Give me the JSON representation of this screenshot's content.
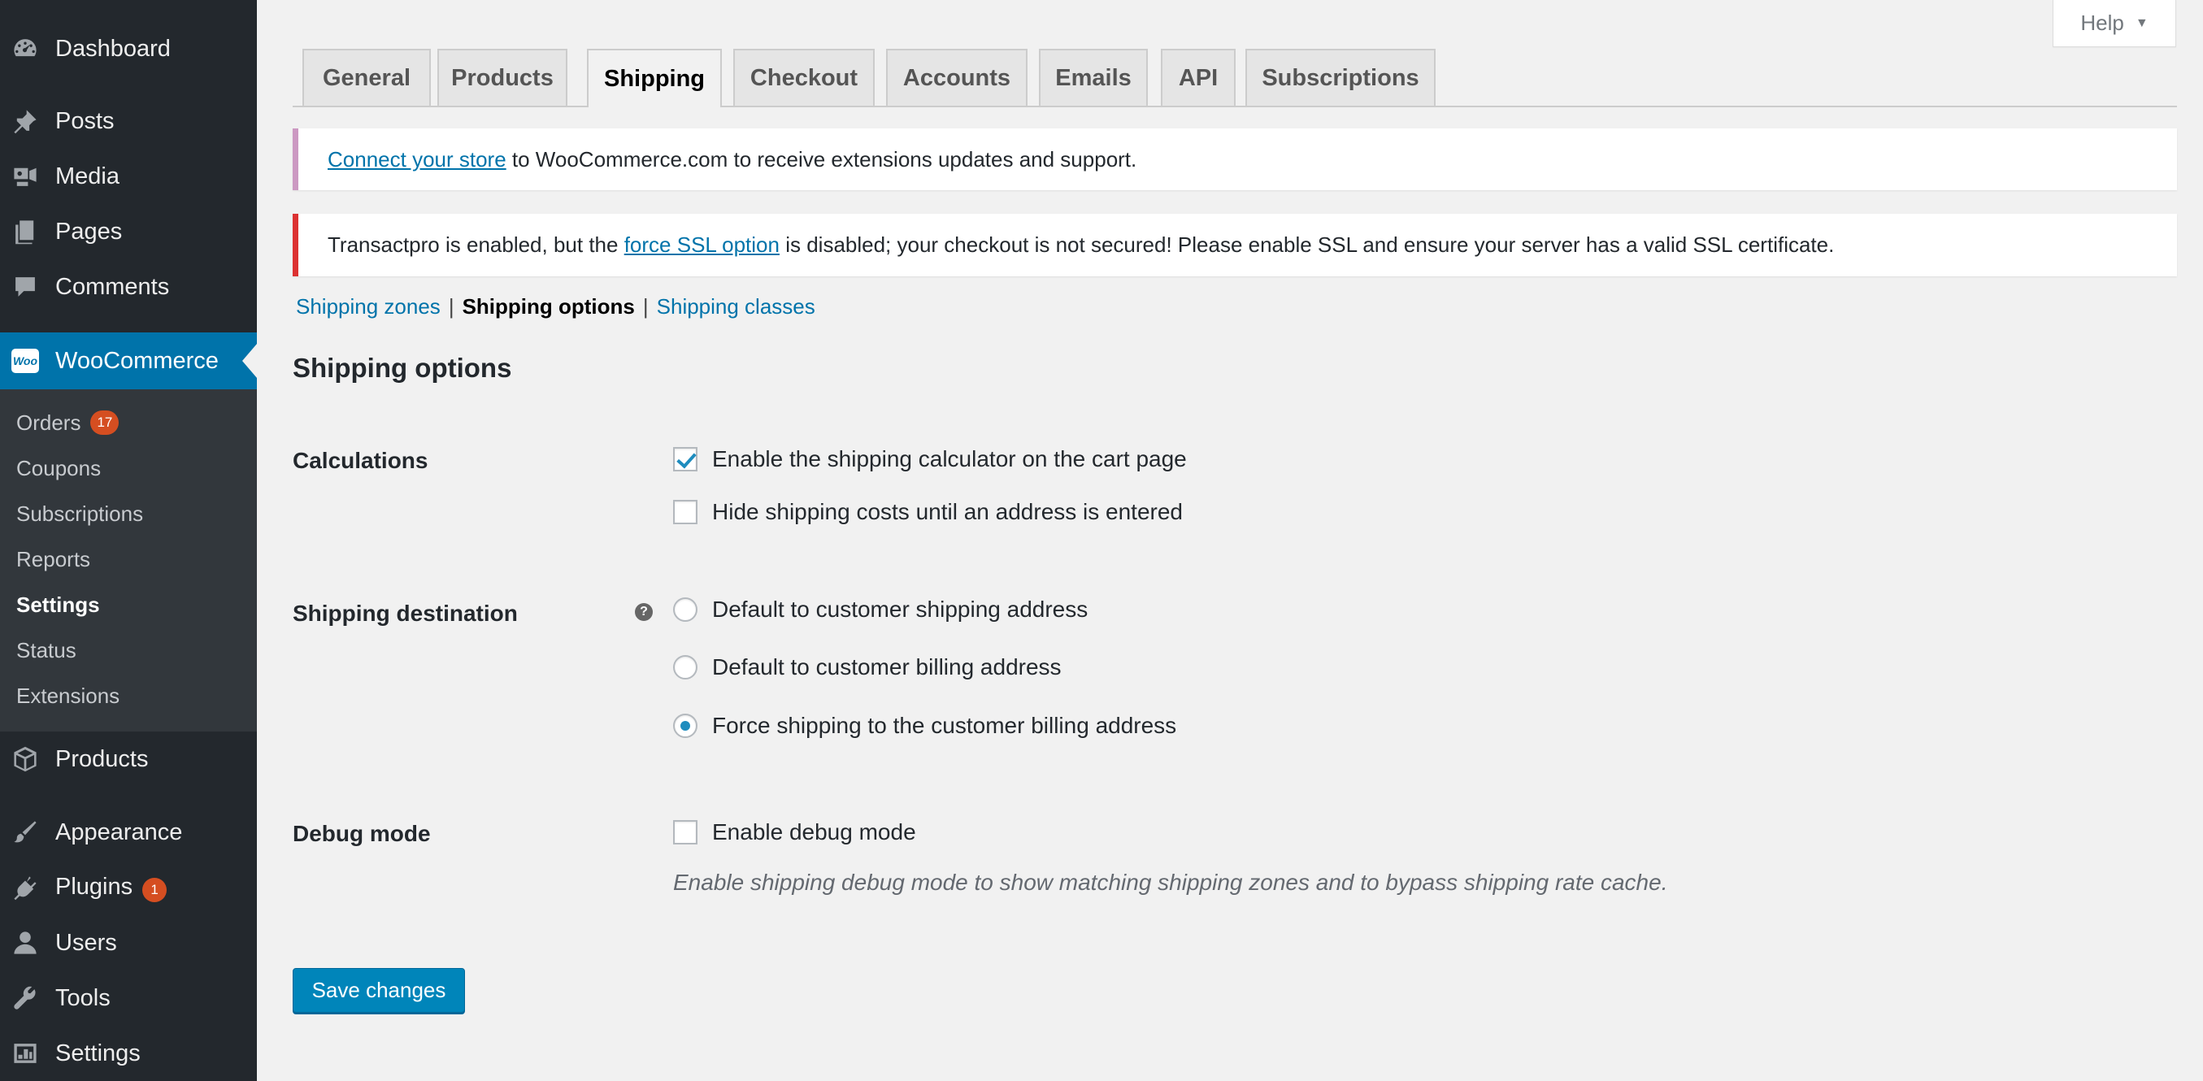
{
  "sidebar": {
    "top_items": [
      {
        "label": "Dashboard",
        "icon": "dashboard-icon"
      },
      {
        "label": "Posts",
        "icon": "pin-icon"
      },
      {
        "label": "Media",
        "icon": "media-icon"
      },
      {
        "label": "Pages",
        "icon": "pages-icon"
      },
      {
        "label": "Comments",
        "icon": "comment-icon"
      }
    ],
    "woocommerce": {
      "label": "WooCommerce",
      "logo_text": "Woo"
    },
    "submenu": [
      {
        "label": "Orders",
        "badge": "17"
      },
      {
        "label": "Coupons"
      },
      {
        "label": "Subscriptions"
      },
      {
        "label": "Reports"
      },
      {
        "label": "Settings",
        "current": true
      },
      {
        "label": "Status"
      },
      {
        "label": "Extensions"
      }
    ],
    "bottom_items": [
      {
        "label": "Products",
        "icon": "box-icon"
      },
      {
        "label": "Appearance",
        "icon": "brush-icon"
      },
      {
        "label": "Plugins",
        "icon": "plug-icon",
        "badge": "1"
      },
      {
        "label": "Users",
        "icon": "user-icon"
      },
      {
        "label": "Tools",
        "icon": "wrench-icon"
      },
      {
        "label": "Settings",
        "icon": "settings-icon"
      }
    ]
  },
  "help": {
    "label": "Help",
    "caret": "▼"
  },
  "tabs": [
    {
      "label": "General"
    },
    {
      "label": "Products"
    },
    {
      "label": "Shipping",
      "active": true
    },
    {
      "label": "Checkout"
    },
    {
      "label": "Accounts"
    },
    {
      "label": "Emails"
    },
    {
      "label": "API"
    },
    {
      "label": "Subscriptions"
    }
  ],
  "notices": {
    "connect": {
      "link": "Connect your store",
      "text": " to WooCommerce.com to receive extensions updates and support."
    },
    "ssl": {
      "before": "Transactpro is enabled, but the ",
      "link": "force SSL option",
      "after": " is disabled; your checkout is not secured! Please enable SSL and ensure your server has a valid SSL certificate."
    }
  },
  "subnav": {
    "zones": "Shipping zones",
    "options": "Shipping options",
    "classes": "Shipping classes",
    "separator": "|"
  },
  "page_title": "Shipping options",
  "calculations": {
    "label": "Calculations",
    "options": [
      {
        "label": "Enable the shipping calculator on the cart page",
        "checked": true
      },
      {
        "label": "Hide shipping costs until an address is entered",
        "checked": false
      }
    ]
  },
  "destination": {
    "label": "Shipping destination",
    "help_tip": "?",
    "options": [
      {
        "label": "Default to customer shipping address",
        "checked": false
      },
      {
        "label": "Default to customer billing address",
        "checked": false
      },
      {
        "label": "Force shipping to the customer billing address",
        "checked": true
      }
    ]
  },
  "debug": {
    "label": "Debug mode",
    "option": {
      "label": "Enable debug mode",
      "checked": false
    },
    "description": "Enable shipping debug mode to show matching shipping zones and to bypass shipping rate cache."
  },
  "save_button": "Save changes",
  "colors": {
    "sidebar_bg": "#23282d",
    "submenu_bg": "#32373c",
    "accent": "#0073aa",
    "button": "#0085ba",
    "badge": "#d54e21",
    "ssl_notice_border": "#dc3232",
    "connect_notice_border": "#cc99c2"
  }
}
